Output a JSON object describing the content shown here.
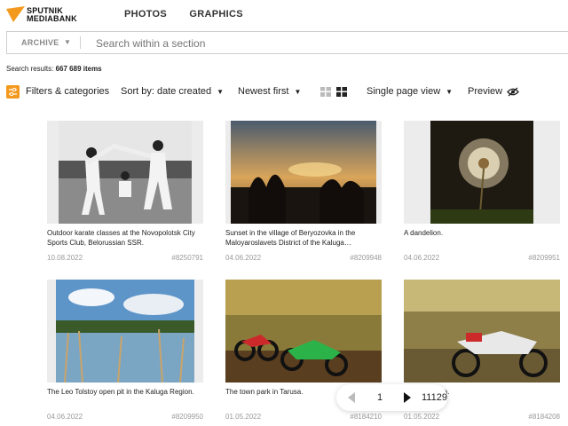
{
  "brand": {
    "name_line1": "SPUTNIK",
    "name_line2": "MEDIABANK",
    "accent": "#f39a1e"
  },
  "nav": {
    "items": [
      {
        "label": "PHOTOS"
      },
      {
        "label": "GRAPHICS"
      }
    ]
  },
  "search": {
    "section": "ARCHIVE",
    "placeholder": "Search within a section"
  },
  "results": {
    "label": "Search results:",
    "count": "667 689 items"
  },
  "toolbar": {
    "filters_label": "Filters & categories",
    "sort_label": "Sort by: date created",
    "order_label": "Newest first",
    "page_view_label": "Single page view",
    "preview_label": "Preview"
  },
  "cards": [
    {
      "caption": "Outdoor karate classes at the Novopolotsk City Sports Club, Belorussian SSR.",
      "date": "10.08.2022",
      "id": "#8250791"
    },
    {
      "caption": "Sunset in the village of Beryozovka in the Maloyaroslavets District of the Kaluga…",
      "date": "04.06.2022",
      "id": "#8209948"
    },
    {
      "caption": "A dandelion.",
      "date": "04.06.2022",
      "id": "#8209951"
    },
    {
      "caption": "The Leo Tolstoy open pit in the Kaluga Region.",
      "date": "04.06.2022",
      "id": "#8209950"
    },
    {
      "caption": "The town park in Tarusa.",
      "date": "01.05.2022",
      "id": "#8184210"
    },
    {
      "caption": "…rk in Tarusa.",
      "date": "01.05.2022",
      "id": "#8184208"
    }
  ],
  "pager": {
    "current": "1",
    "total": "11129"
  }
}
